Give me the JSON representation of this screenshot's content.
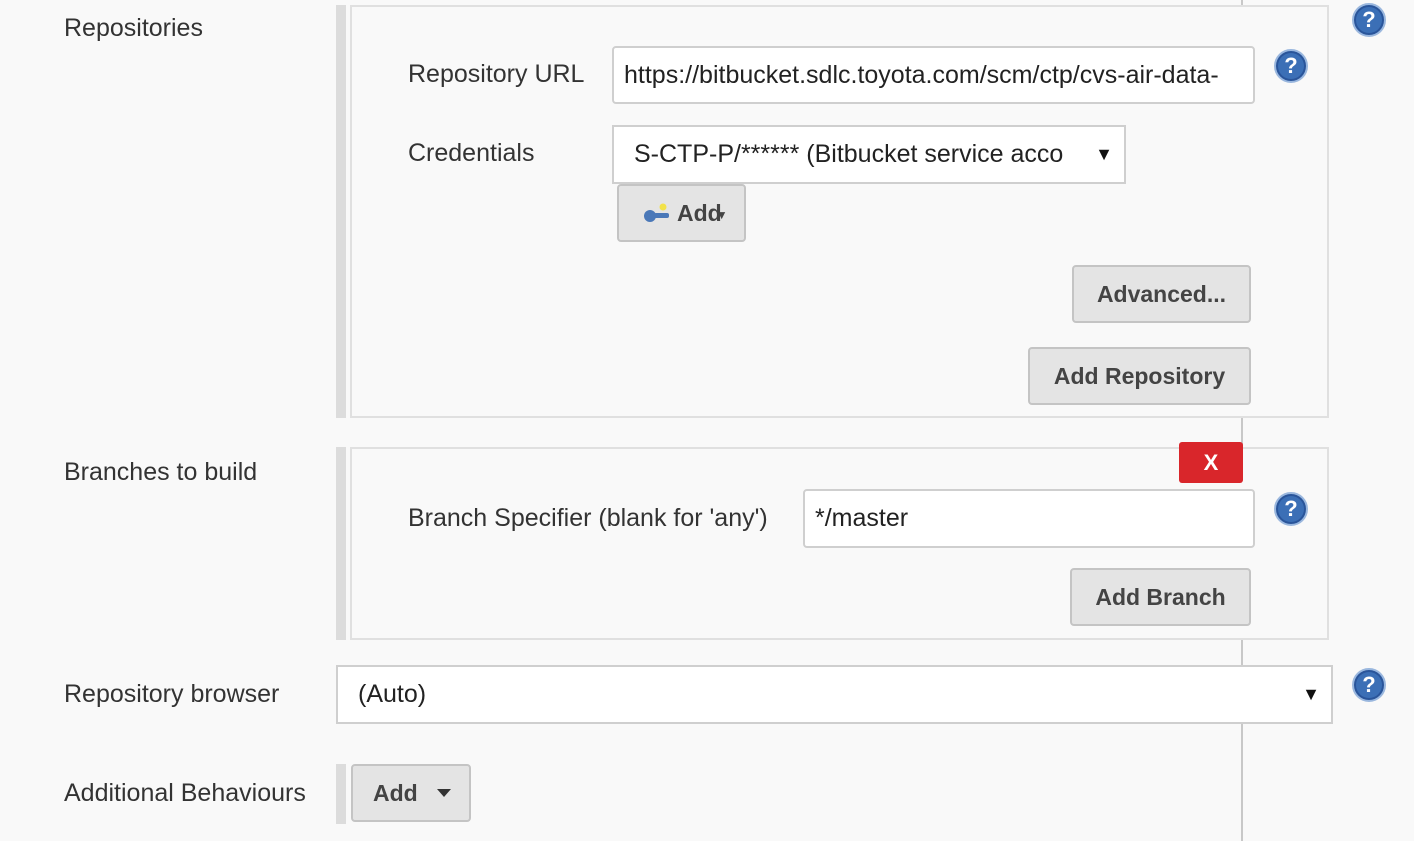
{
  "repositories": {
    "label": "Repositories",
    "repository_url_label": "Repository URL",
    "repository_url_value": "https://bitbucket.sdlc.toyota.com/scm/ctp/cvs-air-data-",
    "credentials_label": "Credentials",
    "credentials_value": "S-CTP-P/****** (Bitbucket service acco",
    "credentials_arrow": "▼",
    "add_credentials_label": "Add",
    "advanced_label": "Advanced...",
    "add_repository_label": "Add Repository"
  },
  "branches": {
    "label": "Branches to build",
    "delete_label": "X",
    "branch_specifier_label": "Branch Specifier (blank for 'any')",
    "branch_specifier_value": "*/master",
    "add_branch_label": "Add Branch"
  },
  "repository_browser": {
    "label": "Repository browser",
    "value": "(Auto)",
    "arrow": "▼"
  },
  "additional_behaviours": {
    "label": "Additional Behaviours",
    "add_label": "Add"
  },
  "help_icon_text": "?",
  "colors": {
    "help_blue": "#3b6fb6",
    "delete_red": "#d9262b",
    "button_gray": "#e4e4e4"
  }
}
